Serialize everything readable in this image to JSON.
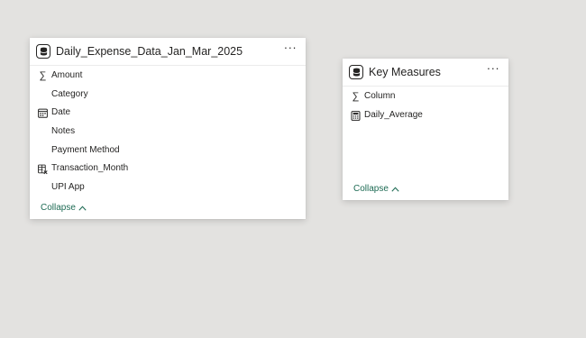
{
  "tables": [
    {
      "title": "Daily_Expense_Data_Jan_Mar_2025",
      "more_label": "···",
      "fields": [
        {
          "label": "Amount",
          "icon": "sigma-icon",
          "glyph": "∑"
        },
        {
          "label": "Category",
          "icon": "",
          "glyph": ""
        },
        {
          "label": "Date",
          "icon": "calendar-icon",
          "glyph": ""
        },
        {
          "label": "Notes",
          "icon": "",
          "glyph": ""
        },
        {
          "label": "Payment Method",
          "icon": "",
          "glyph": ""
        },
        {
          "label": "Transaction_Month",
          "icon": "calculated-column-icon",
          "glyph": ""
        },
        {
          "label": "UPI App",
          "icon": "",
          "glyph": ""
        }
      ],
      "collapse_label": "Collapse"
    },
    {
      "title": "Key Measures",
      "more_label": "···",
      "fields": [
        {
          "label": "Column",
          "icon": "sigma-icon",
          "glyph": "∑"
        },
        {
          "label": "Daily_Average",
          "icon": "calculator-icon",
          "glyph": ""
        }
      ],
      "collapse_label": "Collapse"
    }
  ],
  "colors": {
    "canvas": "#e3e2e0",
    "card": "#ffffff",
    "text": "#252423",
    "accent": "#1e6b54"
  }
}
